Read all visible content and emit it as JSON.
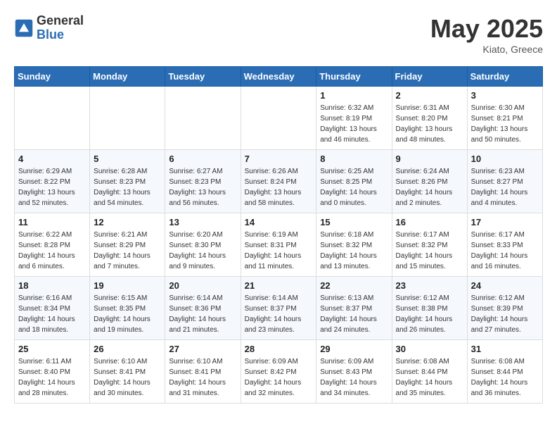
{
  "logo": {
    "general": "General",
    "blue": "Blue"
  },
  "header": {
    "month": "May 2025",
    "location": "Kiato, Greece"
  },
  "days_of_week": [
    "Sunday",
    "Monday",
    "Tuesday",
    "Wednesday",
    "Thursday",
    "Friday",
    "Saturday"
  ],
  "weeks": [
    [
      {
        "day": "",
        "info": ""
      },
      {
        "day": "",
        "info": ""
      },
      {
        "day": "",
        "info": ""
      },
      {
        "day": "",
        "info": ""
      },
      {
        "day": "1",
        "info": "Sunrise: 6:32 AM\nSunset: 8:19 PM\nDaylight: 13 hours\nand 46 minutes."
      },
      {
        "day": "2",
        "info": "Sunrise: 6:31 AM\nSunset: 8:20 PM\nDaylight: 13 hours\nand 48 minutes."
      },
      {
        "day": "3",
        "info": "Sunrise: 6:30 AM\nSunset: 8:21 PM\nDaylight: 13 hours\nand 50 minutes."
      }
    ],
    [
      {
        "day": "4",
        "info": "Sunrise: 6:29 AM\nSunset: 8:22 PM\nDaylight: 13 hours\nand 52 minutes."
      },
      {
        "day": "5",
        "info": "Sunrise: 6:28 AM\nSunset: 8:23 PM\nDaylight: 13 hours\nand 54 minutes."
      },
      {
        "day": "6",
        "info": "Sunrise: 6:27 AM\nSunset: 8:23 PM\nDaylight: 13 hours\nand 56 minutes."
      },
      {
        "day": "7",
        "info": "Sunrise: 6:26 AM\nSunset: 8:24 PM\nDaylight: 13 hours\nand 58 minutes."
      },
      {
        "day": "8",
        "info": "Sunrise: 6:25 AM\nSunset: 8:25 PM\nDaylight: 14 hours\nand 0 minutes."
      },
      {
        "day": "9",
        "info": "Sunrise: 6:24 AM\nSunset: 8:26 PM\nDaylight: 14 hours\nand 2 minutes."
      },
      {
        "day": "10",
        "info": "Sunrise: 6:23 AM\nSunset: 8:27 PM\nDaylight: 14 hours\nand 4 minutes."
      }
    ],
    [
      {
        "day": "11",
        "info": "Sunrise: 6:22 AM\nSunset: 8:28 PM\nDaylight: 14 hours\nand 6 minutes."
      },
      {
        "day": "12",
        "info": "Sunrise: 6:21 AM\nSunset: 8:29 PM\nDaylight: 14 hours\nand 7 minutes."
      },
      {
        "day": "13",
        "info": "Sunrise: 6:20 AM\nSunset: 8:30 PM\nDaylight: 14 hours\nand 9 minutes."
      },
      {
        "day": "14",
        "info": "Sunrise: 6:19 AM\nSunset: 8:31 PM\nDaylight: 14 hours\nand 11 minutes."
      },
      {
        "day": "15",
        "info": "Sunrise: 6:18 AM\nSunset: 8:32 PM\nDaylight: 14 hours\nand 13 minutes."
      },
      {
        "day": "16",
        "info": "Sunrise: 6:17 AM\nSunset: 8:32 PM\nDaylight: 14 hours\nand 15 minutes."
      },
      {
        "day": "17",
        "info": "Sunrise: 6:17 AM\nSunset: 8:33 PM\nDaylight: 14 hours\nand 16 minutes."
      }
    ],
    [
      {
        "day": "18",
        "info": "Sunrise: 6:16 AM\nSunset: 8:34 PM\nDaylight: 14 hours\nand 18 minutes."
      },
      {
        "day": "19",
        "info": "Sunrise: 6:15 AM\nSunset: 8:35 PM\nDaylight: 14 hours\nand 19 minutes."
      },
      {
        "day": "20",
        "info": "Sunrise: 6:14 AM\nSunset: 8:36 PM\nDaylight: 14 hours\nand 21 minutes."
      },
      {
        "day": "21",
        "info": "Sunrise: 6:14 AM\nSunset: 8:37 PM\nDaylight: 14 hours\nand 23 minutes."
      },
      {
        "day": "22",
        "info": "Sunrise: 6:13 AM\nSunset: 8:37 PM\nDaylight: 14 hours\nand 24 minutes."
      },
      {
        "day": "23",
        "info": "Sunrise: 6:12 AM\nSunset: 8:38 PM\nDaylight: 14 hours\nand 26 minutes."
      },
      {
        "day": "24",
        "info": "Sunrise: 6:12 AM\nSunset: 8:39 PM\nDaylight: 14 hours\nand 27 minutes."
      }
    ],
    [
      {
        "day": "25",
        "info": "Sunrise: 6:11 AM\nSunset: 8:40 PM\nDaylight: 14 hours\nand 28 minutes."
      },
      {
        "day": "26",
        "info": "Sunrise: 6:10 AM\nSunset: 8:41 PM\nDaylight: 14 hours\nand 30 minutes."
      },
      {
        "day": "27",
        "info": "Sunrise: 6:10 AM\nSunset: 8:41 PM\nDaylight: 14 hours\nand 31 minutes."
      },
      {
        "day": "28",
        "info": "Sunrise: 6:09 AM\nSunset: 8:42 PM\nDaylight: 14 hours\nand 32 minutes."
      },
      {
        "day": "29",
        "info": "Sunrise: 6:09 AM\nSunset: 8:43 PM\nDaylight: 14 hours\nand 34 minutes."
      },
      {
        "day": "30",
        "info": "Sunrise: 6:08 AM\nSunset: 8:44 PM\nDaylight: 14 hours\nand 35 minutes."
      },
      {
        "day": "31",
        "info": "Sunrise: 6:08 AM\nSunset: 8:44 PM\nDaylight: 14 hours\nand 36 minutes."
      }
    ]
  ]
}
